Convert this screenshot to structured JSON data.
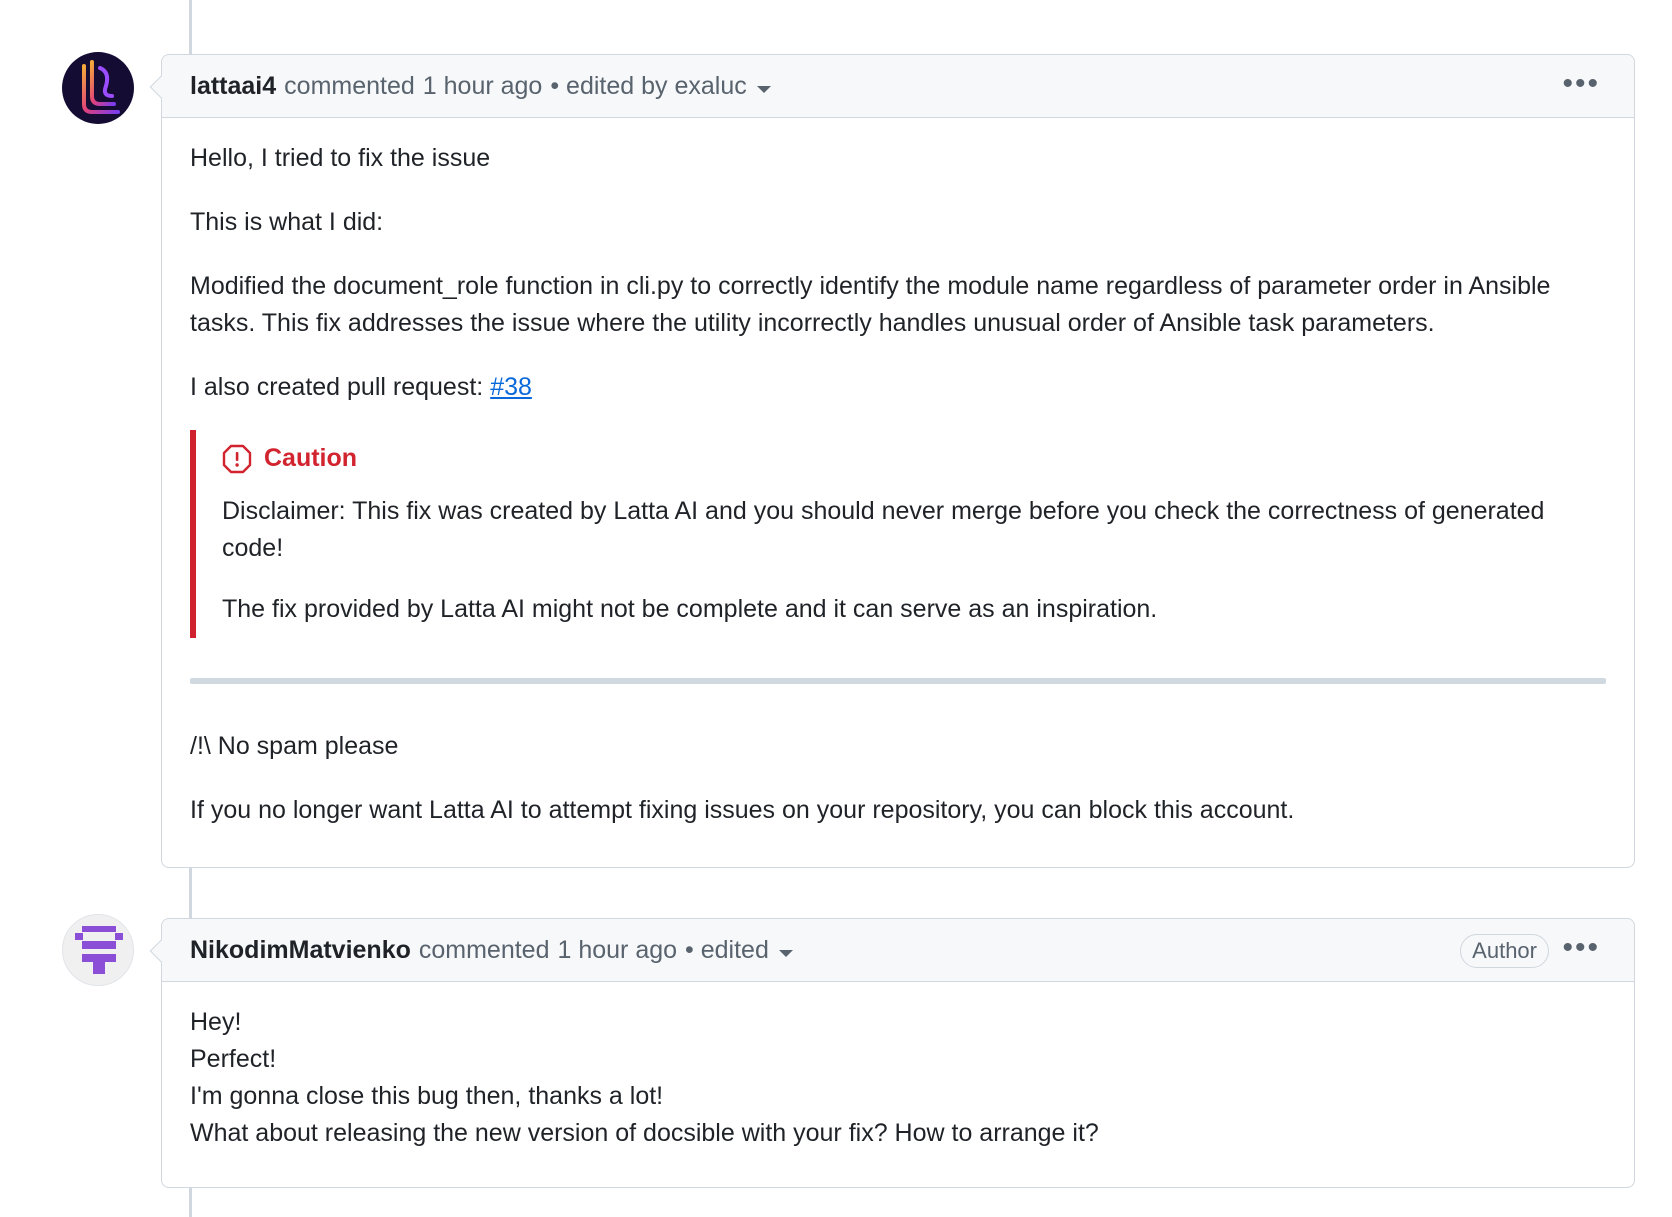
{
  "comments": [
    {
      "author": "lattaai4",
      "action": "commented",
      "time": "1 hour ago",
      "edited": "• edited by exaluc",
      "body": {
        "p1": "Hello, I tried to fix the issue",
        "p2": "This is what I did:",
        "p3": "Modified the document_role function in cli.py to correctly identify the module name regardless of parameter order in Ansible tasks. This fix addresses the issue where the utility incorrectly handles unusual order of Ansible task parameters.",
        "p4_prefix": "I also created pull request:",
        "p4_link": "#38",
        "caution": {
          "title": "Caution",
          "line1": "Disclaimer: This fix was created by Latta AI and you should never merge before you check the correctness of generated code!",
          "line2": "The fix provided by Latta AI might not be complete and it can serve as an inspiration."
        },
        "p5": "/!\\ No spam please",
        "p6": "If you no longer want Latta AI to attempt fixing issues on your repository, you can block this account."
      }
    },
    {
      "author": "NikodimMatvienko",
      "action": "commented",
      "time": "1 hour ago",
      "edited": "• edited",
      "badge": "Author",
      "body": {
        "lines": [
          "Hey!",
          "Perfect!",
          "I'm gonna close this bug then, thanks a lot!",
          "What about releasing the new version of docsible with your fix? How to arrange it?"
        ]
      }
    }
  ],
  "icons": {
    "more": "kebab-horizontal-icon",
    "caret": "triangle-down-icon",
    "caution": "stop-icon"
  },
  "colors": {
    "caution": "#d1242f",
    "link": "#0969da",
    "border": "#d0d7de",
    "header_bg": "#f6f8fa"
  }
}
